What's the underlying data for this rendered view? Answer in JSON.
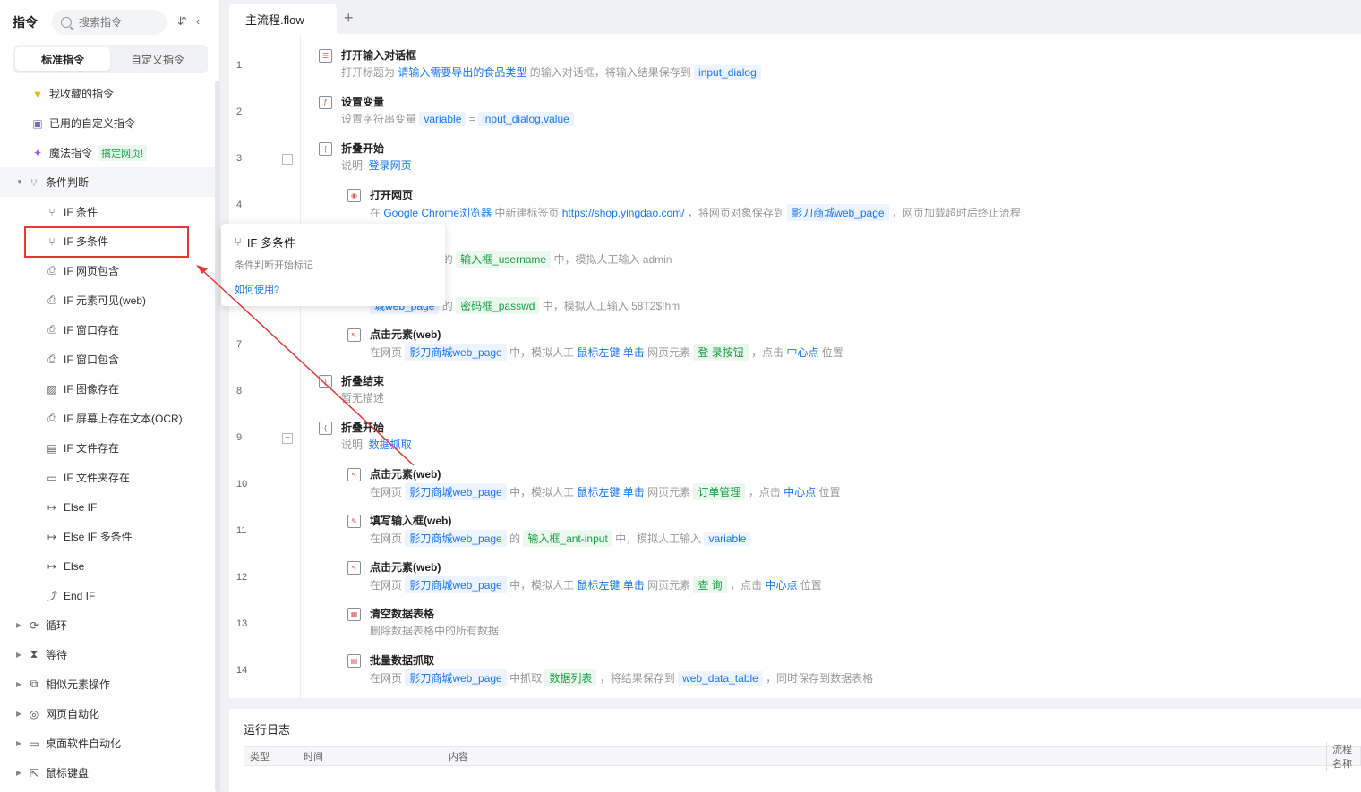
{
  "sidebar": {
    "title": "指令",
    "search_placeholder": "搜索指令",
    "tabs": [
      "标准指令",
      "自定义指令"
    ],
    "favorites": [
      {
        "label": "我收藏的指令",
        "icon": "heart-icon"
      },
      {
        "label": "已用的自定义指令",
        "icon": "bag-icon"
      },
      {
        "label": "魔法指令",
        "icon": "sparkle-icon",
        "tag": "搞定网页!"
      }
    ],
    "category_condition": "条件判断",
    "condition_items": [
      "IF 条件",
      "IF 多条件",
      "IF 网页包含",
      "IF 元素可见(web)",
      "IF 窗口存在",
      "IF 窗口包含",
      "IF 图像存在",
      "IF 屏幕上存在文本(OCR)",
      "IF 文件存在",
      "IF 文件夹存在",
      "Else IF",
      "Else IF 多条件",
      "Else",
      "End IF"
    ],
    "categories": [
      "循环",
      "等待",
      "相似元素操作",
      "网页自动化",
      "桌面软件自动化",
      "鼠标键盘"
    ]
  },
  "tooltip": {
    "title": "IF 多条件",
    "desc": "条件判断开始标记",
    "link": "如何使用?"
  },
  "tabs": {
    "file": "主流程.flow",
    "add": "+"
  },
  "flow": {
    "line_numbers": [
      "1",
      "2",
      "3",
      "4",
      "5",
      "6",
      "7",
      "8",
      "9",
      "10",
      "11",
      "12",
      "13",
      "14"
    ],
    "rows": [
      {
        "title": "打开输入对话框",
        "d": [
          "打开标题为 ",
          "请输入需要导出的食品类型",
          " 的输入对话框，将输入结果保存到 ",
          "input_dialog"
        ]
      },
      {
        "title": "设置变量",
        "d": [
          "设置字符串变量 ",
          "variable",
          " = ",
          "input_dialog.value"
        ]
      },
      {
        "title": "折叠开始",
        "d": [
          "说明:  ",
          "登录网页"
        ]
      },
      {
        "title": "打开网页",
        "d": [
          "在 ",
          "Google Chrome浏览器",
          " 中新建标签页 ",
          "https://shop.yingdao.com/",
          " ，将网页对象保存到 ",
          "影刀商城web_page",
          " ，网页加载超时后终止流程"
        ]
      },
      {
        "title": "p)",
        "d": [
          "",
          "城web_page",
          " 的 ",
          "输入框_username",
          " 中，模拟人工输入 ",
          "admin"
        ]
      },
      {
        "title": "p)",
        "d": [
          "",
          "城web_page",
          " 的 ",
          "密码框_passwd",
          " 中，模拟人工输入 ",
          "58T2$!hm"
        ]
      },
      {
        "title": "点击元素(web)",
        "d": [
          "在网页 ",
          "影刀商城web_page",
          " 中，模拟人工 ",
          "鼠标左键 单击",
          " 网页元素 ",
          "登 录按钮",
          " ，点击 ",
          "中心点",
          " 位置"
        ]
      },
      {
        "title": "折叠结束",
        "d": [
          "暂无描述"
        ]
      },
      {
        "title": "折叠开始",
        "d": [
          "说明:  ",
          "数据抓取"
        ]
      },
      {
        "title": "点击元素(web)",
        "d": [
          "在网页 ",
          "影刀商城web_page",
          " 中，模拟人工 ",
          "鼠标左键 单击",
          " 网页元素 ",
          "订单管理",
          " ，点击 ",
          "中心点",
          " 位置"
        ]
      },
      {
        "title": "填写输入框(web)",
        "d": [
          "在网页 ",
          "影刀商城web_page",
          " 的 ",
          "输入框_ant-input",
          " 中，模拟人工输入 ",
          "variable"
        ]
      },
      {
        "title": "点击元素(web)",
        "d": [
          "在网页 ",
          "影刀商城web_page",
          " 中，模拟人工 ",
          "鼠标左键 单击",
          " 网页元素 ",
          "查 询",
          " ，点击 ",
          "中心点",
          " 位置"
        ]
      },
      {
        "title": "清空数据表格",
        "d": [
          "删除数据表格中的所有数据"
        ]
      },
      {
        "title": "批量数据抓取",
        "d": [
          "在网页 ",
          "影刀商城web_page",
          " 中抓取 ",
          "数据列表",
          " ，将结果保存到 ",
          "web_data_table",
          " ，同时保存到数据表格"
        ]
      }
    ]
  },
  "log": {
    "title": "运行日志",
    "columns": [
      "类型",
      "时间",
      "内容",
      "流程名称"
    ]
  },
  "colors": {
    "accent": "#1677ff",
    "highlight_box": "#e53935",
    "green_tag": "#1a9e45"
  }
}
